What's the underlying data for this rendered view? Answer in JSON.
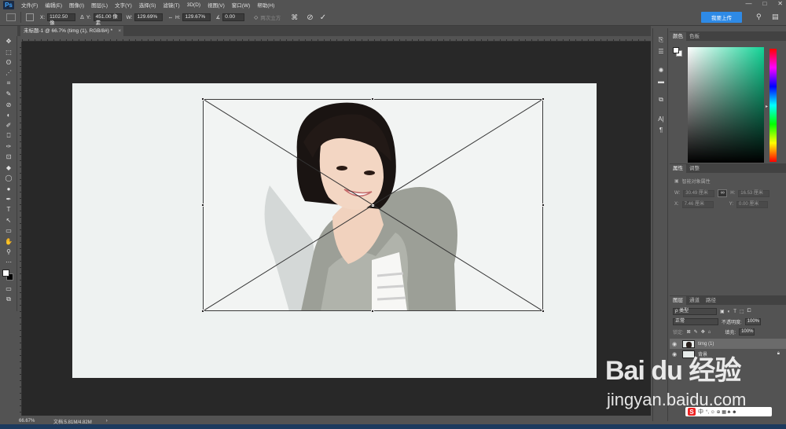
{
  "menu": {
    "logo": "Ps",
    "items": [
      "文件(F)",
      "编辑(E)",
      "图像(I)",
      "图层(L)",
      "文字(Y)",
      "选择(S)",
      "滤镜(T)",
      "3D(D)",
      "视图(V)",
      "窗口(W)",
      "帮助(H)"
    ],
    "window_controls": [
      "—",
      "□",
      "✕"
    ]
  },
  "options": {
    "x_label": "X:",
    "x_value": "1102.50 像",
    "y_label": "Y:",
    "y_value": "451.00 像素",
    "w_label": "W:",
    "w_value": "129.69%",
    "h_label": "H:",
    "h_value": "129.67%",
    "angle_label": "∡",
    "angle_value": "0.00",
    "interp_label": "两次立方",
    "cloud_button": "我要上传",
    "cancel_symbol": "⊘",
    "commit_symbol": "✓"
  },
  "document": {
    "tab_title": "未标题-1 @ 66.7% (timg (1), RGB/8#) *",
    "tab_close": "×"
  },
  "status": {
    "zoom": "66.67%",
    "doc_info": "文档:5.81M/4.82M",
    "arrow": "›"
  },
  "panels": {
    "color_tabs": [
      "颜色",
      "色板"
    ],
    "properties_tabs": [
      "属性",
      "调整"
    ],
    "properties_subtitle": "智能对象属性",
    "prop_w_label": "W:",
    "prop_w_value": "30.49 厘米",
    "prop_h_label": "H:",
    "prop_h_value": "16.53 厘米",
    "prop_x_label": "X:",
    "prop_x_value": "7.46 厘米",
    "prop_y_label": "Y:",
    "prop_y_value": "0.00 厘米",
    "layers_tabs": [
      "图层",
      "通道",
      "路径"
    ],
    "kind_filter": "ρ 类型",
    "blend_mode": "正常",
    "opacity_label": "不透明度:",
    "opacity_value": "100%",
    "lock_label": "锁定:",
    "fill_label": "填充:",
    "fill_value": "100%",
    "layers": [
      {
        "name": "timg (1)",
        "selected": true
      },
      {
        "name": "背景",
        "selected": false
      }
    ]
  },
  "tools": [
    "✥",
    "⬚",
    "ʘ",
    "⋰",
    "⌗",
    "✎",
    "⊘",
    "◐",
    "✐",
    "⎕",
    "✑",
    "⊡",
    "◆",
    "◯",
    "●",
    "✒",
    "T",
    "↖",
    "▭",
    "✋",
    "⚲",
    "⋯"
  ],
  "watermark": {
    "logo": "Bai du 经验",
    "url": "jingyan.baidu.com"
  },
  "ime": {
    "logo": "S",
    "mode": "中",
    "symbols": "°, ☺ ⊕ ▦ ♣ ☻"
  }
}
